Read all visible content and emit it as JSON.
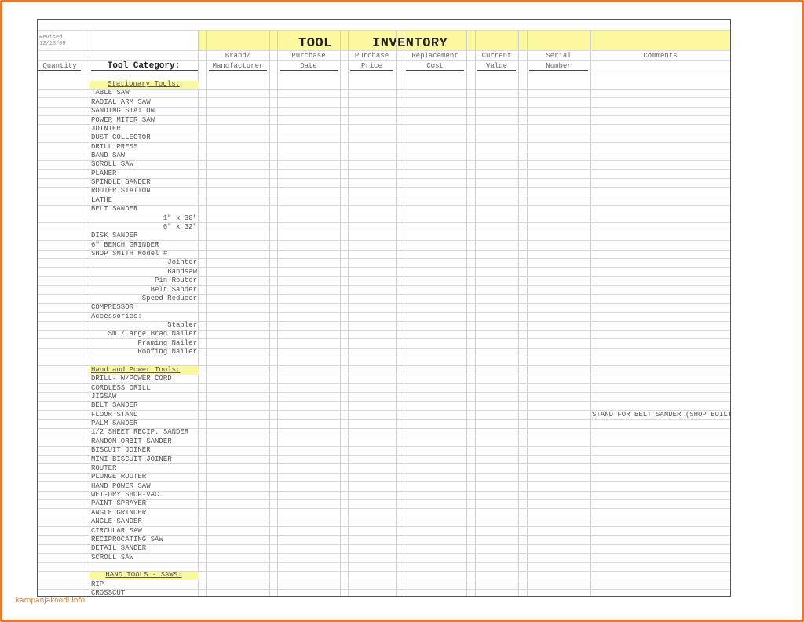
{
  "header": {
    "revised_label": "Revised",
    "revised_date": "12/18/00",
    "title_word1": "TOOL",
    "title_word2": "INVENTORY",
    "quantity": "Quantity",
    "tool_category": "Tool Category:",
    "columns": [
      {
        "line1": "Brand/",
        "line2": "Manufacturer"
      },
      {
        "line1": "Purchase",
        "line2": "Date"
      },
      {
        "line1": "Purchase",
        "line2": "Price"
      },
      {
        "line1": "Replacement",
        "line2": "Cost"
      },
      {
        "line1": "Current",
        "line2": "Value"
      },
      {
        "line1": "Serial",
        "line2": "Number"
      },
      {
        "line1": "Comments",
        "line2": ""
      }
    ]
  },
  "items": [
    {
      "text": "Stationary Tools:",
      "style": "section-center"
    },
    {
      "text": "TABLE SAW"
    },
    {
      "text": "RADIAL ARM SAW"
    },
    {
      "text": "SANDING STATION"
    },
    {
      "text": "POWER MITER SAW"
    },
    {
      "text": "JOINTER"
    },
    {
      "text": "DUST COLLECTOR"
    },
    {
      "text": "DRILL PRESS"
    },
    {
      "text": "BAND SAW"
    },
    {
      "text": "SCROLL SAW"
    },
    {
      "text": "PLANER"
    },
    {
      "text": "SPINDLE SANDER"
    },
    {
      "text": "ROUTER STATION"
    },
    {
      "text": "LATHE"
    },
    {
      "text": "BELT SANDER"
    },
    {
      "text": "1\" x 30\"",
      "style": "sub"
    },
    {
      "text": "6\" x 32\"",
      "style": "sub"
    },
    {
      "text": "DISK SANDER"
    },
    {
      "text": "6\" BENCH GRINDER"
    },
    {
      "text": "SHOP SMITH Model #"
    },
    {
      "text": "Jointer",
      "style": "sub"
    },
    {
      "text": "Bandsaw",
      "style": "sub"
    },
    {
      "text": "Pin Router",
      "style": "sub"
    },
    {
      "text": "Belt Sander",
      "style": "sub"
    },
    {
      "text": "Speed Reducer",
      "style": "sub"
    },
    {
      "text": "COMPRESSOR"
    },
    {
      "text": "Accessories:"
    },
    {
      "text": "Stapler",
      "style": "sub"
    },
    {
      "text": "Sm./Large Brad Nailer",
      "style": "sub"
    },
    {
      "text": "Framing Nailer",
      "style": "sub"
    },
    {
      "text": "Roofing Nailer",
      "style": "sub"
    },
    {
      "text": ""
    },
    {
      "text": "Hand and Power Tools:",
      "style": "section-left"
    },
    {
      "text": "DRILL- W/POWER CORD"
    },
    {
      "text": "CORDLESS DRILL"
    },
    {
      "text": "JIGSAW"
    },
    {
      "text": "BELT SANDER"
    },
    {
      "text": "FLOOR STAND",
      "comment": "STAND FOR BELT SANDER (SHOP BUILT)"
    },
    {
      "text": "PALM SANDER"
    },
    {
      "text": "1/2 SHEET RECIP. SANDER"
    },
    {
      "text": "RANDOM ORBIT SANDER"
    },
    {
      "text": "BISCUIT JOINER"
    },
    {
      "text": "MINI BISCUIT JOINER"
    },
    {
      "text": "ROUTER"
    },
    {
      "text": "PLUNGE ROUTER"
    },
    {
      "text": "HAND POWER SAW"
    },
    {
      "text": "WET-DRY SHOP-VAC"
    },
    {
      "text": "PAINT SPRAYER"
    },
    {
      "text": "ANGLE GRINDER"
    },
    {
      "text": "ANGLE SANDER"
    },
    {
      "text": "CIRCULAR SAW"
    },
    {
      "text": "RECIPROCATING SAW"
    },
    {
      "text": "DETAIL SANDER"
    },
    {
      "text": "SCROLL SAW"
    },
    {
      "text": ""
    },
    {
      "text": "HAND TOOLS - SAWS:",
      "style": "section-center"
    },
    {
      "text": "RIP"
    },
    {
      "text": "CROSSCUT"
    }
  ],
  "colors": {
    "highlight": "#fbf8a0",
    "border": "#e8782a",
    "watermark": "#e07a2a"
  },
  "watermark": "kampanjakoodi.info"
}
